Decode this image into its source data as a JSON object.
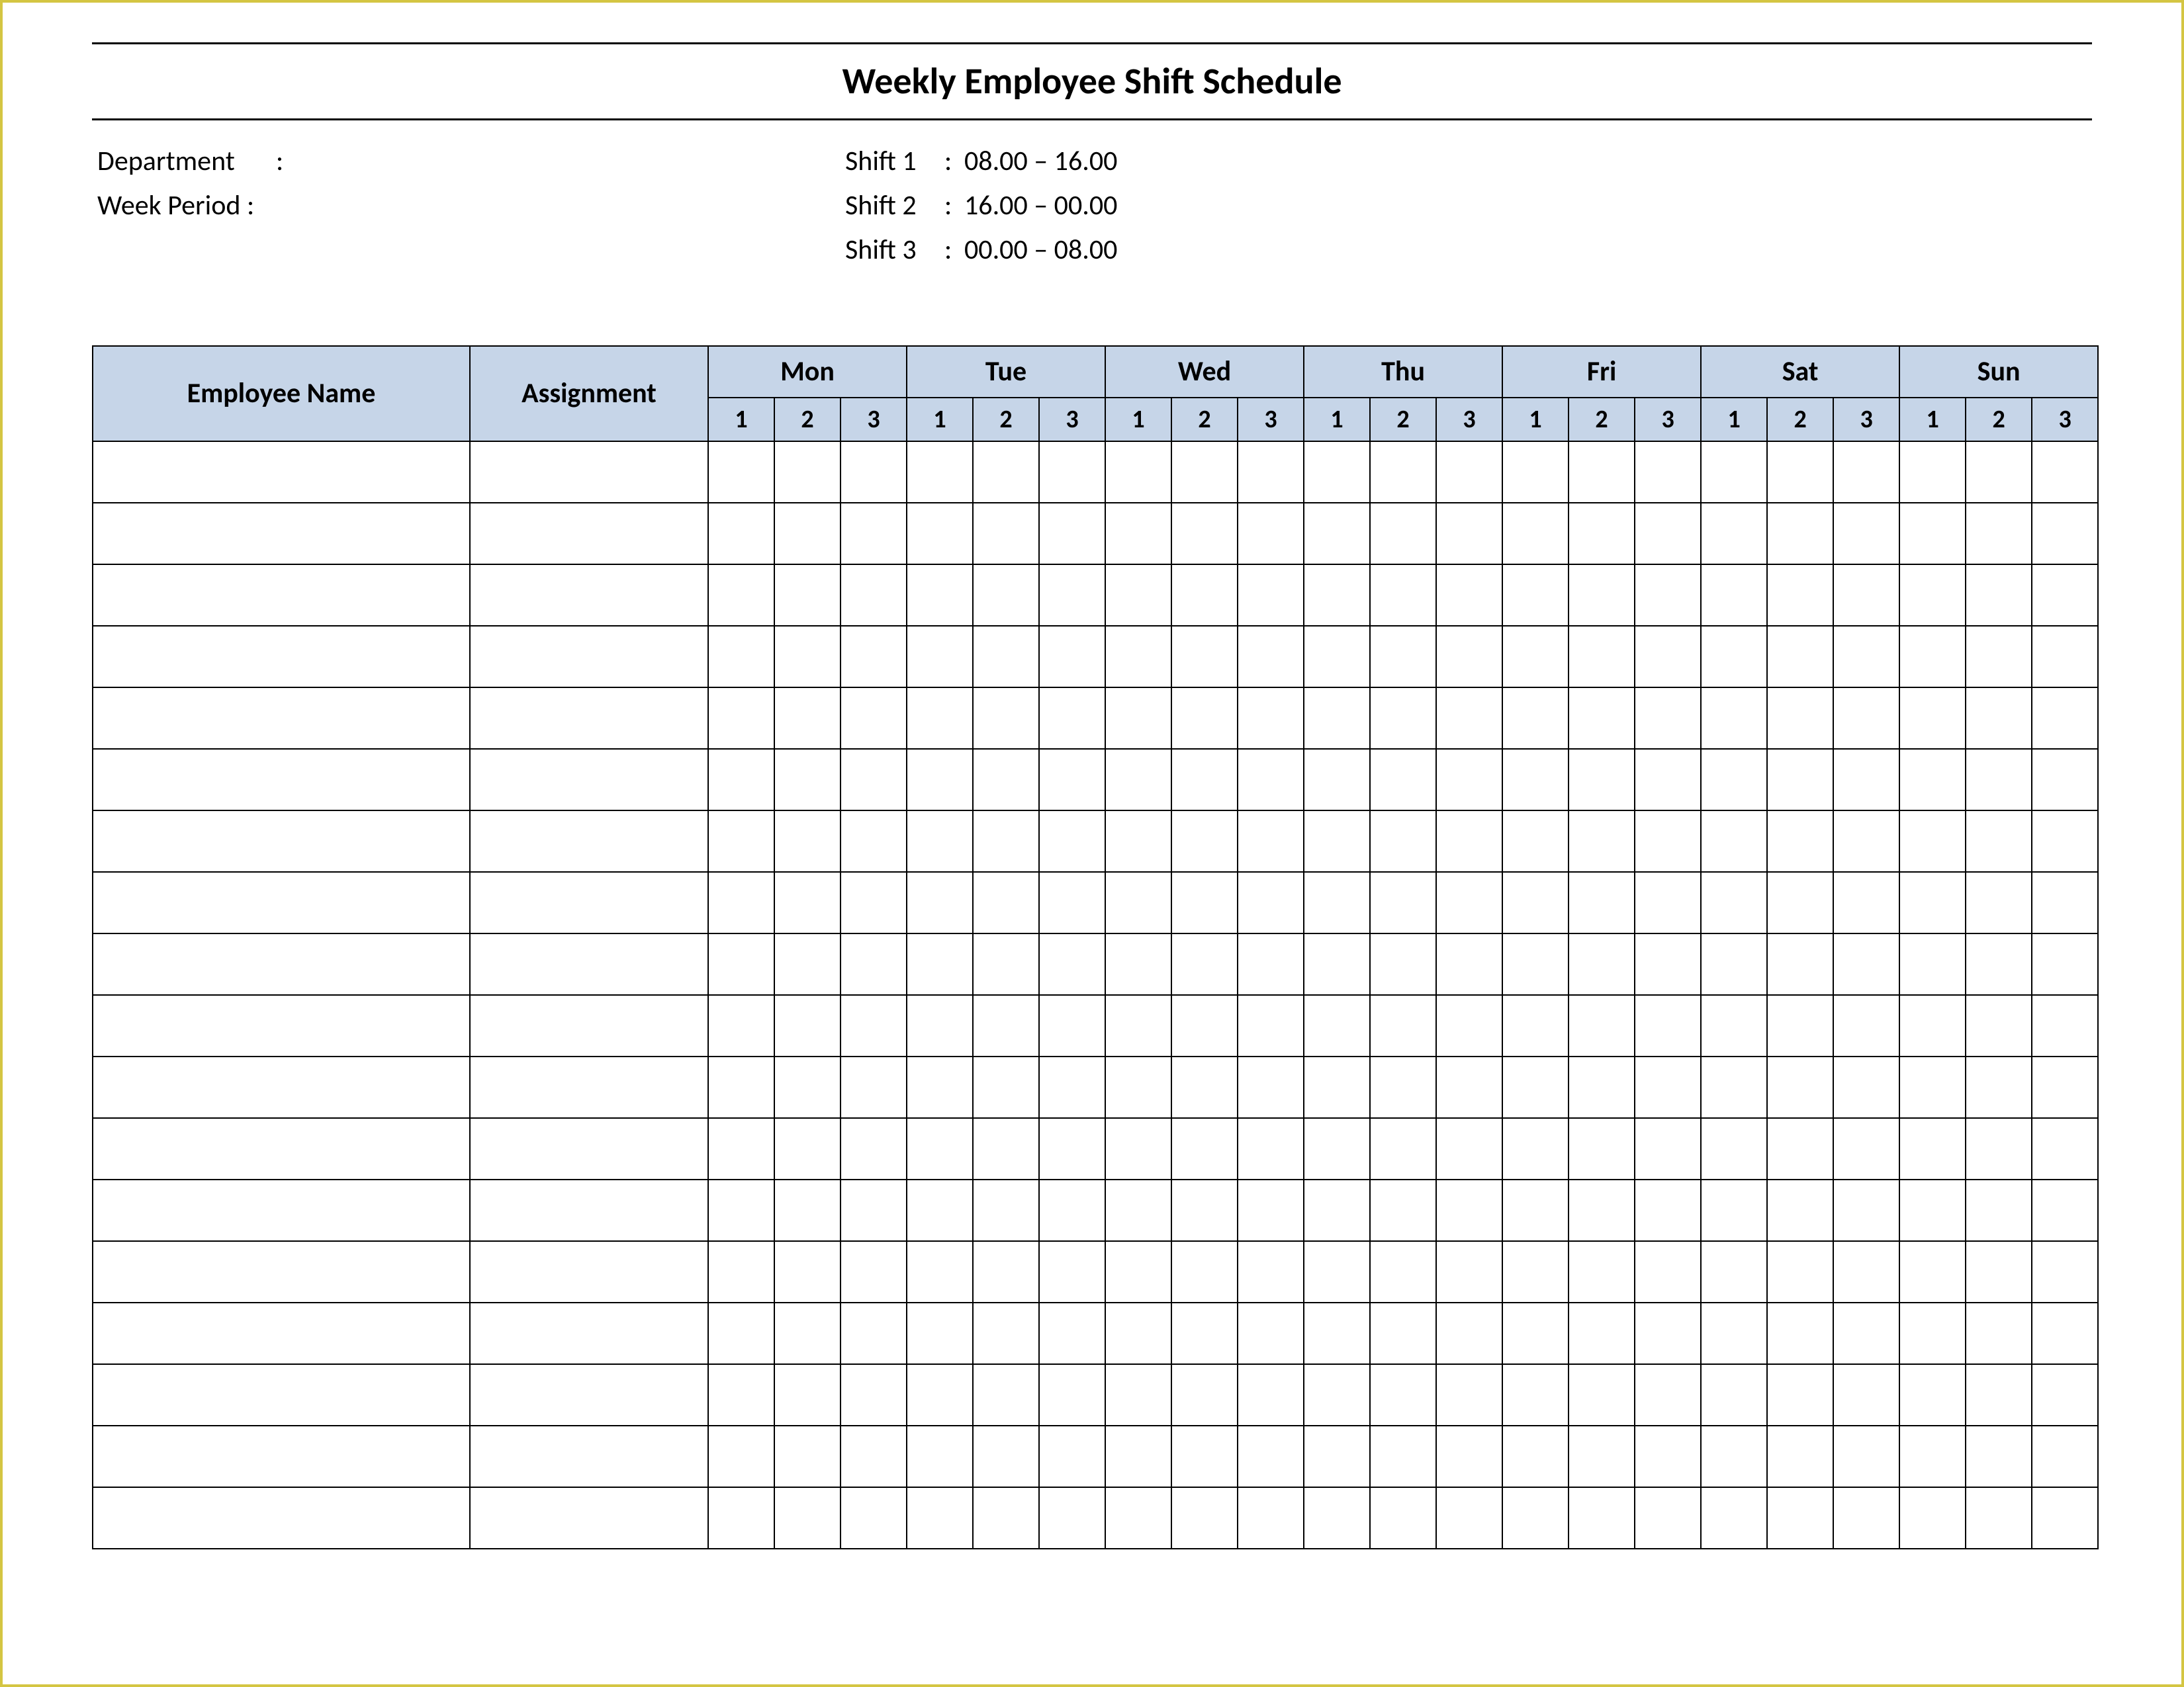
{
  "title": "Weekly Employee Shift Schedule",
  "meta_left": {
    "department_label": "Department",
    "department_value": "",
    "week_period_label": "Week  Period :",
    "week_period_value": ""
  },
  "shifts": [
    {
      "label": "Shift 1",
      "time": "08.00  – 16.00"
    },
    {
      "label": "Shift 2",
      "time": "16.00  – 00.00"
    },
    {
      "label": "Shift 3",
      "time": "00.00  – 08.00"
    }
  ],
  "table": {
    "head": {
      "employee": "Employee Name",
      "assignment": "Assignment",
      "days": [
        "Mon",
        "Tue",
        "Wed",
        "Thu",
        "Fri",
        "Sat",
        "Sun"
      ],
      "sub": [
        "1",
        "2",
        "3"
      ]
    },
    "rows": [
      {
        "employee": "",
        "assignment": "",
        "cells": [
          "",
          "",
          "",
          "",
          "",
          "",
          "",
          "",
          "",
          "",
          "",
          "",
          "",
          "",
          "",
          "",
          "",
          "",
          "",
          "",
          ""
        ]
      },
      {
        "employee": "",
        "assignment": "",
        "cells": [
          "",
          "",
          "",
          "",
          "",
          "",
          "",
          "",
          "",
          "",
          "",
          "",
          "",
          "",
          "",
          "",
          "",
          "",
          "",
          "",
          ""
        ]
      },
      {
        "employee": "",
        "assignment": "",
        "cells": [
          "",
          "",
          "",
          "",
          "",
          "",
          "",
          "",
          "",
          "",
          "",
          "",
          "",
          "",
          "",
          "",
          "",
          "",
          "",
          "",
          ""
        ]
      },
      {
        "employee": "",
        "assignment": "",
        "cells": [
          "",
          "",
          "",
          "",
          "",
          "",
          "",
          "",
          "",
          "",
          "",
          "",
          "",
          "",
          "",
          "",
          "",
          "",
          "",
          "",
          ""
        ]
      },
      {
        "employee": "",
        "assignment": "",
        "cells": [
          "",
          "",
          "",
          "",
          "",
          "",
          "",
          "",
          "",
          "",
          "",
          "",
          "",
          "",
          "",
          "",
          "",
          "",
          "",
          "",
          ""
        ]
      },
      {
        "employee": "",
        "assignment": "",
        "cells": [
          "",
          "",
          "",
          "",
          "",
          "",
          "",
          "",
          "",
          "",
          "",
          "",
          "",
          "",
          "",
          "",
          "",
          "",
          "",
          "",
          ""
        ]
      },
      {
        "employee": "",
        "assignment": "",
        "cells": [
          "",
          "",
          "",
          "",
          "",
          "",
          "",
          "",
          "",
          "",
          "",
          "",
          "",
          "",
          "",
          "",
          "",
          "",
          "",
          "",
          ""
        ]
      },
      {
        "employee": "",
        "assignment": "",
        "cells": [
          "",
          "",
          "",
          "",
          "",
          "",
          "",
          "",
          "",
          "",
          "",
          "",
          "",
          "",
          "",
          "",
          "",
          "",
          "",
          "",
          ""
        ]
      },
      {
        "employee": "",
        "assignment": "",
        "cells": [
          "",
          "",
          "",
          "",
          "",
          "",
          "",
          "",
          "",
          "",
          "",
          "",
          "",
          "",
          "",
          "",
          "",
          "",
          "",
          "",
          ""
        ]
      },
      {
        "employee": "",
        "assignment": "",
        "cells": [
          "",
          "",
          "",
          "",
          "",
          "",
          "",
          "",
          "",
          "",
          "",
          "",
          "",
          "",
          "",
          "",
          "",
          "",
          "",
          "",
          ""
        ]
      },
      {
        "employee": "",
        "assignment": "",
        "cells": [
          "",
          "",
          "",
          "",
          "",
          "",
          "",
          "",
          "",
          "",
          "",
          "",
          "",
          "",
          "",
          "",
          "",
          "",
          "",
          "",
          ""
        ]
      },
      {
        "employee": "",
        "assignment": "",
        "cells": [
          "",
          "",
          "",
          "",
          "",
          "",
          "",
          "",
          "",
          "",
          "",
          "",
          "",
          "",
          "",
          "",
          "",
          "",
          "",
          "",
          ""
        ]
      },
      {
        "employee": "",
        "assignment": "",
        "cells": [
          "",
          "",
          "",
          "",
          "",
          "",
          "",
          "",
          "",
          "",
          "",
          "",
          "",
          "",
          "",
          "",
          "",
          "",
          "",
          "",
          ""
        ]
      },
      {
        "employee": "",
        "assignment": "",
        "cells": [
          "",
          "",
          "",
          "",
          "",
          "",
          "",
          "",
          "",
          "",
          "",
          "",
          "",
          "",
          "",
          "",
          "",
          "",
          "",
          "",
          ""
        ]
      },
      {
        "employee": "",
        "assignment": "",
        "cells": [
          "",
          "",
          "",
          "",
          "",
          "",
          "",
          "",
          "",
          "",
          "",
          "",
          "",
          "",
          "",
          "",
          "",
          "",
          "",
          "",
          ""
        ]
      },
      {
        "employee": "",
        "assignment": "",
        "cells": [
          "",
          "",
          "",
          "",
          "",
          "",
          "",
          "",
          "",
          "",
          "",
          "",
          "",
          "",
          "",
          "",
          "",
          "",
          "",
          "",
          ""
        ]
      },
      {
        "employee": "",
        "assignment": "",
        "cells": [
          "",
          "",
          "",
          "",
          "",
          "",
          "",
          "",
          "",
          "",
          "",
          "",
          "",
          "",
          "",
          "",
          "",
          "",
          "",
          "",
          ""
        ]
      },
      {
        "employee": "",
        "assignment": "",
        "cells": [
          "",
          "",
          "",
          "",
          "",
          "",
          "",
          "",
          "",
          "",
          "",
          "",
          "",
          "",
          "",
          "",
          "",
          "",
          "",
          "",
          ""
        ]
      }
    ]
  }
}
